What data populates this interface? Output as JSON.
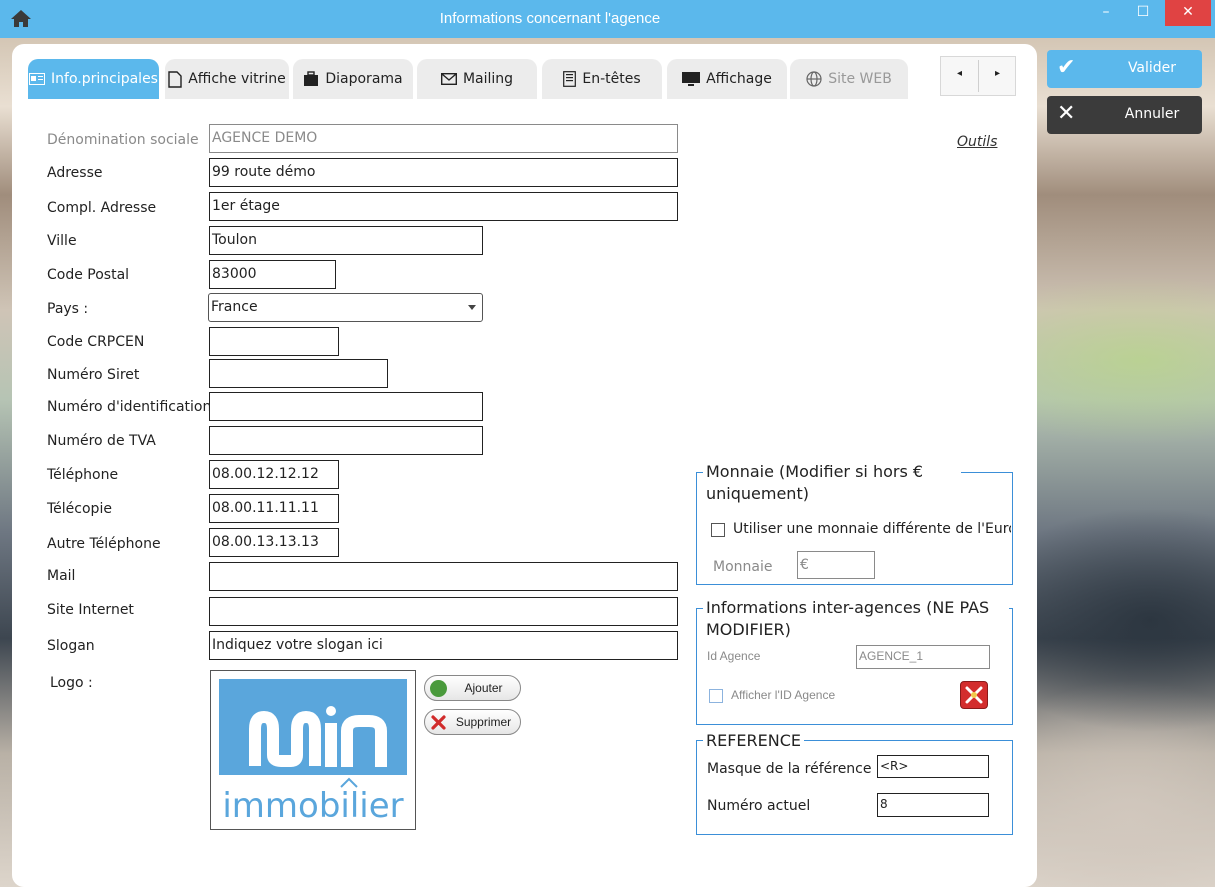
{
  "window": {
    "title": "Informations concernant l'agence",
    "minimize": "–",
    "maximize": "☐",
    "close": "✕",
    "home_icon": "home-icon"
  },
  "actions": {
    "valider": "Valider",
    "annuler": "Annuler"
  },
  "tabs": [
    {
      "label": "Info.principales",
      "icon": "id-card-icon",
      "active": true
    },
    {
      "label": "Affiche vitrine",
      "icon": "document-icon"
    },
    {
      "label": "Diaporama",
      "icon": "briefcase-icon"
    },
    {
      "label": "Mailing",
      "icon": "envelope-icon"
    },
    {
      "label": "En-têtes",
      "icon": "header-doc-icon"
    },
    {
      "label": "Affichage",
      "icon": "monitor-icon"
    },
    {
      "label": "Site WEB",
      "icon": "globe-icon",
      "disabled": true
    }
  ],
  "tab_nav": {
    "prev": "◂",
    "next": "▸"
  },
  "outils": "Outils",
  "form": {
    "denomination": {
      "label": "Dénomination sociale",
      "value": "AGENCE DEMO"
    },
    "adresse": {
      "label": "Adresse",
      "value": "99 route démo"
    },
    "compl_adresse": {
      "label": "Compl. Adresse",
      "value": "1er étage"
    },
    "ville": {
      "label": "Ville",
      "value": "Toulon"
    },
    "code_postal": {
      "label": "Code Postal",
      "value": "83000"
    },
    "pays": {
      "label": "Pays :",
      "value": "France"
    },
    "code_crpcen": {
      "label": "Code CRPCEN",
      "value": ""
    },
    "siret": {
      "label": "Numéro Siret",
      "value": ""
    },
    "identification": {
      "label": "Numéro d'identification",
      "value": ""
    },
    "tva": {
      "label": "Numéro de TVA",
      "value": ""
    },
    "telephone": {
      "label": "Téléphone",
      "value": "08.00.12.12.12"
    },
    "telecopie": {
      "label": "Télécopie",
      "value": "08.00.11.11.11"
    },
    "autre_tel": {
      "label": "Autre Téléphone",
      "value": "08.00.13.13.13"
    },
    "mail": {
      "label": "Mail",
      "value": ""
    },
    "site": {
      "label": "Site Internet",
      "value": ""
    },
    "slogan": {
      "label": "Slogan",
      "value": "Indiquez votre slogan ici"
    },
    "logo": {
      "label": "Logo :",
      "brand_top": "win",
      "brand_bottom": "immobilier"
    }
  },
  "logo_buttons": {
    "ajouter": "Ajouter",
    "supprimer": "Supprimer"
  },
  "monnaie": {
    "legend_line1": "Monnaie (Modifier si hors €",
    "legend_line2": "uniquement)",
    "checkbox_label": "Utiliser une monnaie différente de l'Euro",
    "monnaie_label": "Monnaie",
    "monnaie_value": "€"
  },
  "inter_agences": {
    "legend_line1": "Informations inter-agences (NE PAS",
    "legend_line2": "MODIFIER)",
    "id_label": "Id Agence",
    "id_value": "AGENCE_1",
    "afficher_label": "Afficher l'ID Agence"
  },
  "reference": {
    "legend": "REFERENCE",
    "masque_label": "Masque de la référence",
    "masque_value": "<R>",
    "numero_label": "Numéro actuel",
    "numero_value": "8"
  },
  "colors": {
    "accent": "#5bb8ec",
    "close": "#e04343",
    "annuler": "#3b3b3b",
    "group_border": "#3b8fd8"
  }
}
